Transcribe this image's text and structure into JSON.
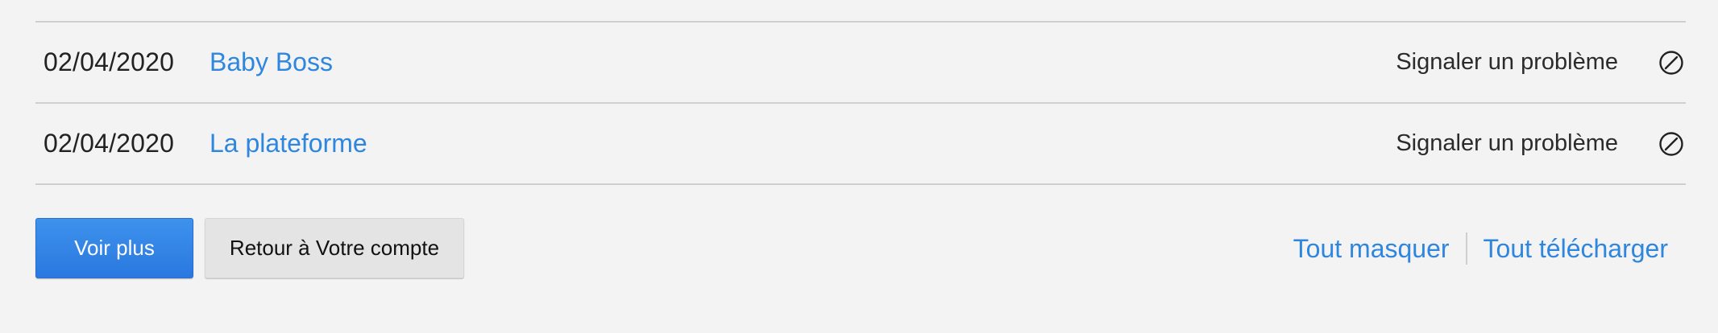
{
  "viewing_activity": {
    "rows": [
      {
        "date": "02/04/2020",
        "title": "Baby Boss",
        "report_label": "Signaler un problème",
        "hide_icon": "block-icon"
      },
      {
        "date": "02/04/2020",
        "title": "La plateforme",
        "report_label": "Signaler un problème",
        "hide_icon": "block-icon"
      }
    ]
  },
  "actions": {
    "see_more_label": "Voir plus",
    "back_label": "Retour à Votre compte",
    "hide_all_label": "Tout masquer",
    "download_all_label": "Tout télécharger"
  },
  "colors": {
    "accent": "#2e86de",
    "background": "#f3f3f3",
    "divider": "#cfcfcf"
  }
}
